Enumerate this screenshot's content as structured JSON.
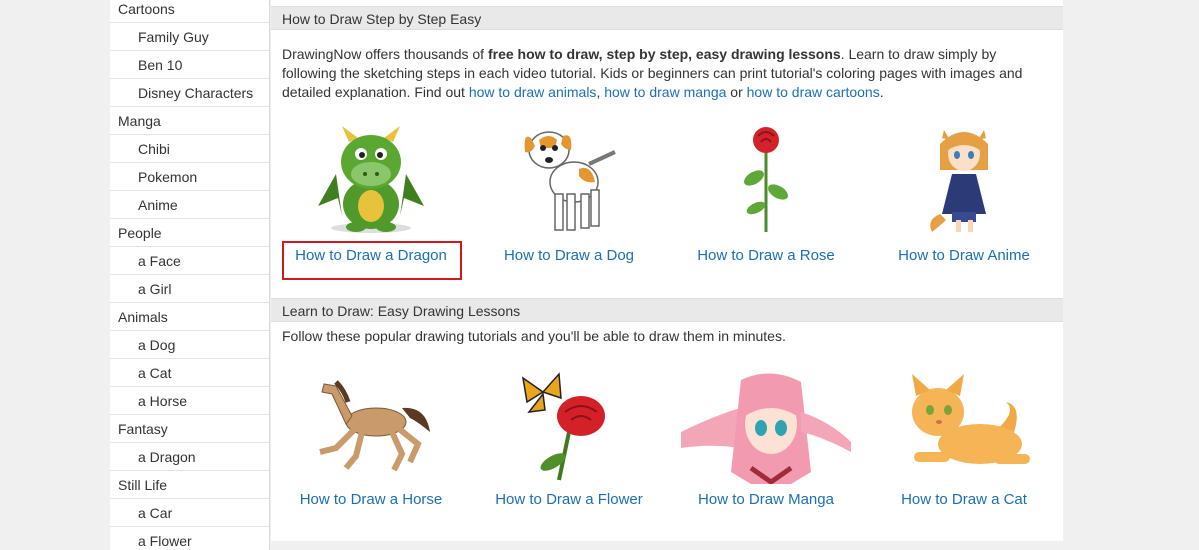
{
  "sidebar": {
    "items": [
      {
        "label": "Cartoons",
        "kind": "cat"
      },
      {
        "label": "Family Guy",
        "kind": "sub"
      },
      {
        "label": "Ben 10",
        "kind": "sub"
      },
      {
        "label": "Disney Characters",
        "kind": "sub"
      },
      {
        "label": "Manga",
        "kind": "cat"
      },
      {
        "label": "Chibi",
        "kind": "sub"
      },
      {
        "label": "Pokemon",
        "kind": "sub"
      },
      {
        "label": "Anime",
        "kind": "sub"
      },
      {
        "label": "People",
        "kind": "cat"
      },
      {
        "label": "a Face",
        "kind": "sub"
      },
      {
        "label": "a Girl",
        "kind": "sub"
      },
      {
        "label": "Animals",
        "kind": "cat"
      },
      {
        "label": "a Dog",
        "kind": "sub"
      },
      {
        "label": "a Cat",
        "kind": "sub"
      },
      {
        "label": "a Horse",
        "kind": "sub"
      },
      {
        "label": "Fantasy",
        "kind": "cat"
      },
      {
        "label": "a Dragon",
        "kind": "sub"
      },
      {
        "label": "Still Life",
        "kind": "cat"
      },
      {
        "label": "a Car",
        "kind": "sub"
      },
      {
        "label": "a Flower",
        "kind": "sub"
      }
    ]
  },
  "section1": {
    "title": "How to Draw Step by Step Easy",
    "intro_a": "DrawingNow offers thousands of ",
    "intro_bold": "free how to draw, step by step, easy drawing lessons",
    "intro_b": ". Learn to draw simply by following the sketching steps in each video tutorial. Kids or beginners can print tutorial's coloring pages with images and detailed explanation. Find out ",
    "link_animals": "how to draw animals",
    "intro_c": ", ",
    "link_manga": "how to draw manga",
    "intro_d": " or ",
    "link_cartoons": "how to draw cartoons",
    "intro_e": ".",
    "tiles": [
      {
        "caption": "How to Draw a Dragon",
        "icon": "dragon-icon"
      },
      {
        "caption": "How to Draw a Dog",
        "icon": "dog-icon"
      },
      {
        "caption": "How to Draw a Rose",
        "icon": "rose-icon"
      },
      {
        "caption": "How to Draw Anime",
        "icon": "anime-icon"
      }
    ]
  },
  "section2": {
    "title": "Learn to Draw: Easy Drawing Lessons",
    "intro": "Follow these popular drawing tutorials and you'll be able to draw them in minutes.",
    "tiles": [
      {
        "caption": "How to Draw a Horse",
        "icon": "horse-icon"
      },
      {
        "caption": "How to Draw a Flower",
        "icon": "flower-icon"
      },
      {
        "caption": "How to Draw Manga",
        "icon": "manga-icon"
      },
      {
        "caption": "How to Draw a Cat",
        "icon": "cat-icon"
      }
    ]
  },
  "colors": {
    "link": "#1a6fb5",
    "highlight_box": "#d0191c",
    "header_bg": "#e9e9e9",
    "page_bg": "#f0f0f0"
  }
}
